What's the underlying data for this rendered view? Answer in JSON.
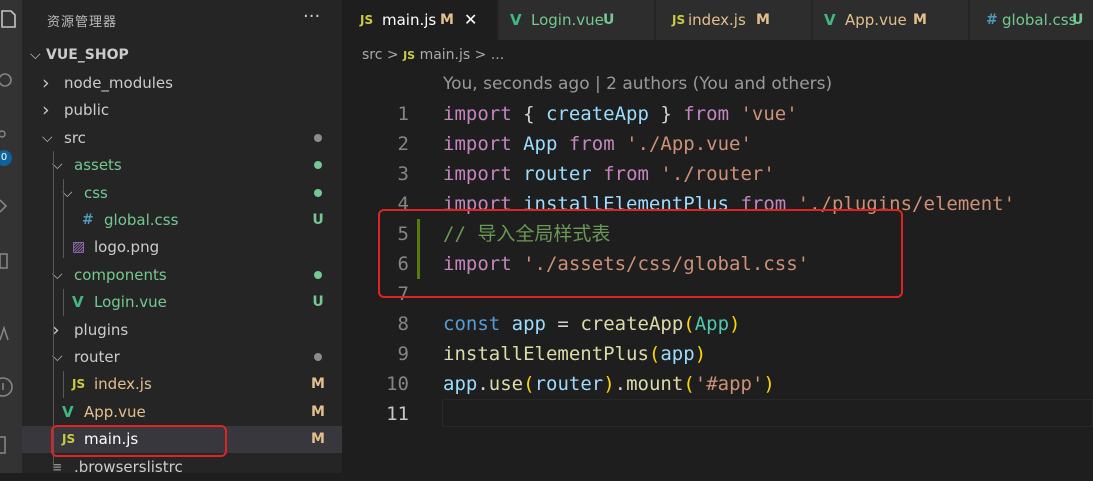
{
  "activity_bar": {
    "icons": [
      "files-icon",
      "search-icon",
      "source-control-icon",
      "run-debug-icon",
      "extensions-icon",
      "remote-icon",
      "account-icon",
      "settings-icon"
    ],
    "badge": "0"
  },
  "sidebar": {
    "title": "资源管理器",
    "more": "···",
    "project": "VUE_SHOP",
    "items": [
      {
        "label": "node_modules",
        "type": "folder",
        "expanded": false,
        "status": ""
      },
      {
        "label": "public",
        "type": "folder",
        "expanded": false,
        "status": ""
      },
      {
        "label": "src",
        "type": "folder",
        "expanded": true,
        "status": "dot"
      },
      {
        "label": "assets",
        "type": "folder",
        "expanded": true,
        "status": "dot"
      },
      {
        "label": "css",
        "type": "folder",
        "expanded": true,
        "status": "dot"
      },
      {
        "label": "global.css",
        "type": "css",
        "status": "U"
      },
      {
        "label": "logo.png",
        "type": "image",
        "status": ""
      },
      {
        "label": "components",
        "type": "folder",
        "expanded": true,
        "status": "dot"
      },
      {
        "label": "Login.vue",
        "type": "vue",
        "status": "U"
      },
      {
        "label": "plugins",
        "type": "folder",
        "expanded": false,
        "status": ""
      },
      {
        "label": "router",
        "type": "folder",
        "expanded": true,
        "status": "dot"
      },
      {
        "label": "index.js",
        "type": "js",
        "status": "M"
      },
      {
        "label": "App.vue",
        "type": "vue",
        "status": "M"
      },
      {
        "label": "main.js",
        "type": "js",
        "status": "M"
      },
      {
        "label": ".browserslistrc",
        "type": "config",
        "status": ""
      }
    ]
  },
  "tabs": [
    {
      "icon": "JS",
      "label": "main.js",
      "status": "M",
      "close": "✕",
      "active": true
    },
    {
      "icon": "V",
      "label": "Login.vue",
      "status": "U",
      "active": false
    },
    {
      "icon": "JS",
      "label": "index.js",
      "status": "M",
      "active": false
    },
    {
      "icon": "V",
      "label": "App.vue",
      "status": "M",
      "active": false
    },
    {
      "icon": "#",
      "label": "global.css",
      "status": "U",
      "active": false
    }
  ],
  "breadcrumb": {
    "folder": "src",
    "sep": ">",
    "icon": "JS",
    "file": "main.js",
    "tail": "> ..."
  },
  "blame": "You, seconds ago | 2 authors (You and others)",
  "editor": {
    "lines": [
      {
        "num": "1",
        "tokens": [
          [
            "kw",
            "import"
          ],
          [
            "pn",
            " { "
          ],
          [
            "var",
            "createApp"
          ],
          [
            "pn",
            " } "
          ],
          [
            "kw",
            "from"
          ],
          [
            "pn",
            " "
          ],
          [
            "str",
            "'vue'"
          ]
        ]
      },
      {
        "num": "2",
        "tokens": [
          [
            "kw",
            "import"
          ],
          [
            "pn",
            " "
          ],
          [
            "var",
            "App"
          ],
          [
            "pn",
            " "
          ],
          [
            "kw",
            "from"
          ],
          [
            "pn",
            " "
          ],
          [
            "str",
            "'./App.vue'"
          ]
        ]
      },
      {
        "num": "3",
        "tokens": [
          [
            "kw",
            "import"
          ],
          [
            "pn",
            " "
          ],
          [
            "var",
            "router"
          ],
          [
            "pn",
            " "
          ],
          [
            "kw",
            "from"
          ],
          [
            "pn",
            " "
          ],
          [
            "str",
            "'./router'"
          ]
        ]
      },
      {
        "num": "4",
        "tokens": [
          [
            "kw",
            "import"
          ],
          [
            "pn",
            " "
          ],
          [
            "var",
            "installElementPlus"
          ],
          [
            "pn",
            " "
          ],
          [
            "kw",
            "from"
          ],
          [
            "pn",
            " "
          ],
          [
            "str",
            "'./plugins/element'"
          ]
        ]
      },
      {
        "num": "5",
        "tokens": [
          [
            "comment",
            "// 导入全局样式表"
          ]
        ]
      },
      {
        "num": "6",
        "tokens": [
          [
            "kw",
            "import"
          ],
          [
            "pn",
            " "
          ],
          [
            "str",
            "'./assets/css/global.css'"
          ]
        ]
      },
      {
        "num": "7",
        "tokens": []
      },
      {
        "num": "8",
        "tokens": [
          [
            "const",
            "const"
          ],
          [
            "pn",
            " "
          ],
          [
            "var",
            "app"
          ],
          [
            "pn",
            " = "
          ],
          [
            "fn",
            "createApp"
          ],
          [
            "br1",
            "("
          ],
          [
            "cls",
            "App"
          ],
          [
            "br1",
            ")"
          ]
        ]
      },
      {
        "num": "9",
        "tokens": [
          [
            "fn",
            "installElementPlus"
          ],
          [
            "br1",
            "("
          ],
          [
            "var",
            "app"
          ],
          [
            "br1",
            ")"
          ]
        ]
      },
      {
        "num": "10",
        "tokens": [
          [
            "var",
            "app"
          ],
          [
            "pn",
            "."
          ],
          [
            "fn",
            "use"
          ],
          [
            "br1",
            "("
          ],
          [
            "var",
            "router"
          ],
          [
            "br1",
            ")"
          ],
          [
            "pn",
            "."
          ],
          [
            "fn",
            "mount"
          ],
          [
            "br1",
            "("
          ],
          [
            "str",
            "'#app'"
          ],
          [
            "br1",
            ")"
          ]
        ]
      },
      {
        "num": "11",
        "tokens": []
      }
    ]
  },
  "colors": {
    "modified": "#e2c08d",
    "untracked": "#73c991",
    "dot_untracked": "#73c991",
    "dot_neutral": "#8c8c8c",
    "highlight": "#e02424"
  }
}
